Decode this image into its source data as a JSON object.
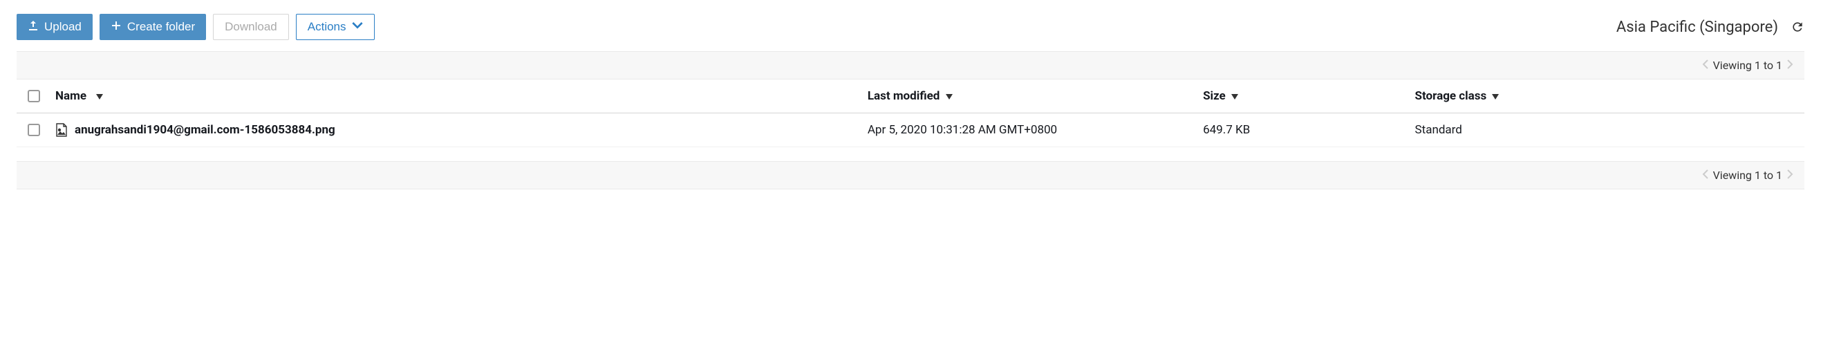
{
  "toolbar": {
    "upload_label": "Upload",
    "create_folder_label": "Create folder",
    "download_label": "Download",
    "actions_label": "Actions",
    "region": "Asia Pacific (Singapore)"
  },
  "pagination": {
    "viewing_text": "Viewing 1 to 1"
  },
  "columns": {
    "name": "Name",
    "last_modified": "Last modified",
    "size": "Size",
    "storage_class": "Storage class"
  },
  "rows": [
    {
      "name": "anugrahsandi1904@gmail.com-1586053884.png",
      "last_modified": "Apr 5, 2020 10:31:28 AM GMT+0800",
      "size": "649.7 KB",
      "storage_class": "Standard"
    }
  ]
}
